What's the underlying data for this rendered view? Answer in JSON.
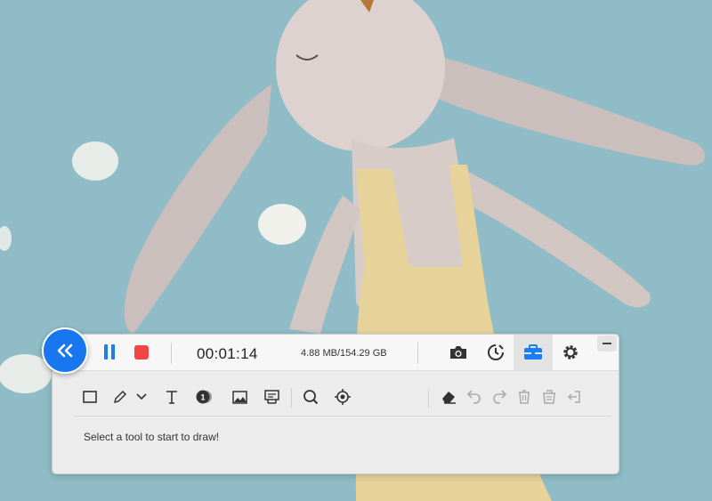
{
  "recorder": {
    "timer": "00:01:14",
    "storage": "4.88 MB/154.29 GB",
    "hint": "Select a tool to start to draw!",
    "step_number": "1"
  },
  "top_icons": [
    "camera-icon",
    "schedule-icon",
    "toolbox-icon",
    "gear-icon"
  ],
  "draw_tools": [
    "rectangle-tool",
    "pen-tool",
    "text-tool",
    "step-tool",
    "image-tool",
    "callout-tool",
    "magnifier-tool",
    "spotlight-tool"
  ],
  "edit_tools": [
    "eraser-tool",
    "undo-tool",
    "redo-tool",
    "delete-tool",
    "clear-tool",
    "exit-tool"
  ],
  "colors": {
    "accent": "#1877ef",
    "stop": "#f04646",
    "background": "#8fbcc6"
  }
}
